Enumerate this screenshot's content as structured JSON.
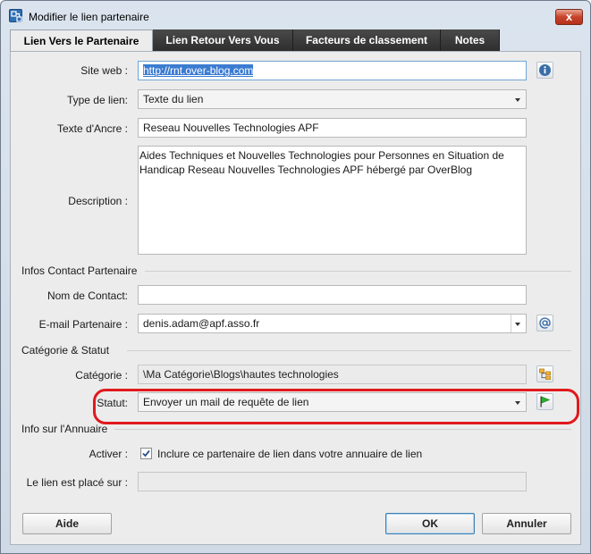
{
  "window": {
    "title": "Modifier le lien partenaire",
    "close_glyph": "x"
  },
  "tabs": [
    {
      "label": "Lien Vers le Partenaire"
    },
    {
      "label": "Lien Retour Vers Vous"
    },
    {
      "label": "Facteurs de classement"
    },
    {
      "label": "Notes"
    }
  ],
  "form": {
    "site_label": "Site web :",
    "site_value": "http://rnt.over-blog.com",
    "type_label": "Type de lien:",
    "type_value": "Texte du lien",
    "anchor_label": "Texte d'Ancre :",
    "anchor_value": "Reseau Nouvelles Technologies APF",
    "description_label": "Description :",
    "description_value": "Aides Techniques et Nouvelles Technologies pour Personnes en Situation de Handicap Reseau Nouvelles Technologies APF hébergé par OverBlog"
  },
  "contact": {
    "section": "Infos Contact Partenaire",
    "name_label": "Nom de Contact:",
    "name_value": "",
    "email_label": "E-mail Partenaire :",
    "email_value": "denis.adam@apf.asso.fr"
  },
  "category": {
    "section": "Catégorie & Statut",
    "category_label": "Catégorie :",
    "category_value": "\\Ma Catégorie\\Blogs\\hautes technologies",
    "status_label": "Statut:",
    "status_value": "Envoyer un mail de requête de lien"
  },
  "directory": {
    "section": "Info sur l'Annuaire",
    "activate_label": "Activer :",
    "activate_checkbox_label": "Inclure ce partenaire de lien dans votre annuaire de lien",
    "activate_checked": true,
    "placed_label": "Le lien est placé sur :",
    "placed_value": ""
  },
  "buttons": {
    "help": "Aide",
    "ok": "OK",
    "cancel": "Annuler"
  },
  "colors": {
    "highlight_ring": "#e0191d",
    "selection": "#3b7bd1",
    "tab_dark": "#3a3a3a"
  },
  "icons": [
    "app-icon",
    "info-icon",
    "at-sign-icon",
    "category-picker-icon",
    "green-flag-icon",
    "checkmark-icon",
    "chevron-down-icon"
  ]
}
